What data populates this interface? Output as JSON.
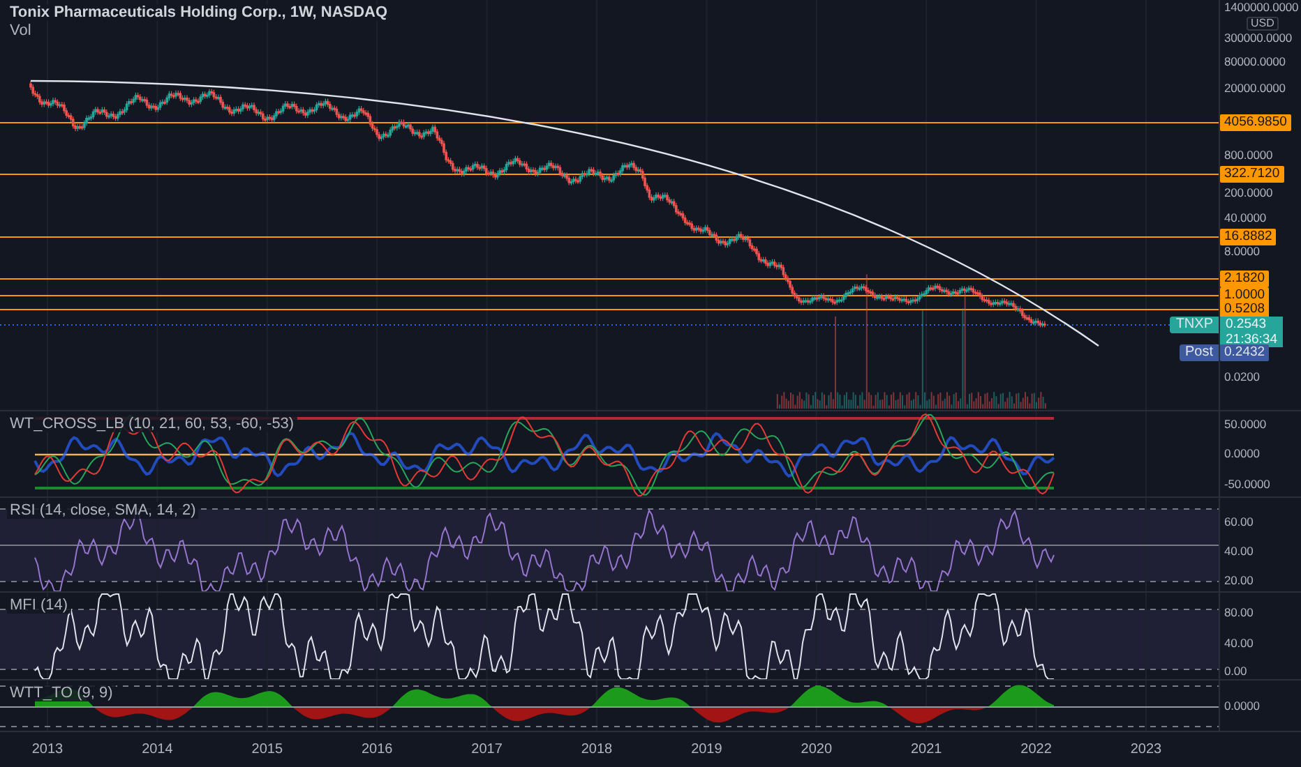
{
  "legend": {
    "title": "Tonix Pharmaceuticals Holding Corp., 1W, NASDAQ",
    "volume": "Vol"
  },
  "price_axis": {
    "currency": "USD",
    "ticks": [
      "1400000.0000",
      "300000.0000",
      "80000.0000",
      "20000.0000",
      "800.0000",
      "200.0000",
      "40.0000",
      "8.0000",
      "0.0200"
    ],
    "levels": [
      "4056.9850",
      "322.7120",
      "16.8882",
      "2.1820",
      "1.0000",
      "0.5208"
    ],
    "last": {
      "symbol": "TNXP",
      "price": "0.2543",
      "countdown": "21:36:34"
    },
    "post": {
      "label": "Post",
      "price": "0.2432"
    }
  },
  "panes": [
    {
      "kind": "wt",
      "legend": "WT_CROSS_LB (10, 21, 60, 53, -60, -53)",
      "ticks": [
        "50.0000",
        "0.0000",
        "-50.0000"
      ]
    },
    {
      "kind": "rsi",
      "legend": "RSI (14, close, SMA, 14, 2)",
      "ticks": [
        "60.00",
        "40.00",
        "20.00"
      ]
    },
    {
      "kind": "mfi",
      "legend": "MFI (14)",
      "ticks": [
        "80.00",
        "40.00",
        "0.00"
      ]
    },
    {
      "kind": "wtt",
      "legend": "WTT_TO (9, 9)",
      "ticks": [
        "0.0000"
      ]
    }
  ],
  "time_axis": [
    "2013",
    "2014",
    "2015",
    "2016",
    "2017",
    "2018",
    "2019",
    "2020",
    "2021",
    "2022",
    "2023"
  ]
}
